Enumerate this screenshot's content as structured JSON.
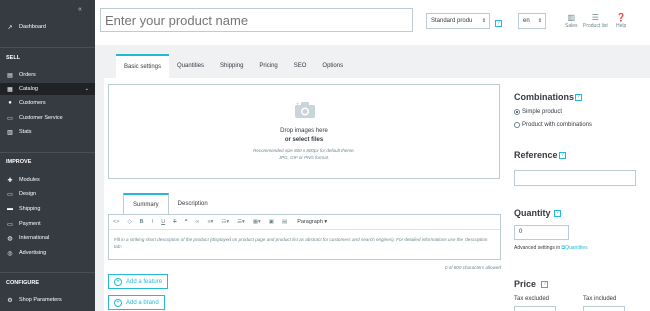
{
  "sidebar": {
    "collapse_glyph": "«",
    "dashboard": "Dashboard",
    "sections": {
      "sell": "SELL",
      "improve": "IMPROVE",
      "configure": "CONFIGURE"
    },
    "sell_items": [
      {
        "label": "Orders",
        "icon": "inbox-icon"
      },
      {
        "label": "Catalog",
        "icon": "store-icon",
        "active": true
      },
      {
        "label": "Customers",
        "icon": "user-icon"
      },
      {
        "label": "Customer Service",
        "icon": "chat-icon"
      },
      {
        "label": "Stats",
        "icon": "stats-icon"
      }
    ],
    "improve_items": [
      {
        "label": "Modules",
        "icon": "puzzle-icon"
      },
      {
        "label": "Design",
        "icon": "monitor-icon"
      },
      {
        "label": "Shipping",
        "icon": "truck-icon"
      },
      {
        "label": "Payment",
        "icon": "card-icon"
      },
      {
        "label": "International",
        "icon": "globe-icon"
      },
      {
        "label": "Advertising",
        "icon": "target-icon"
      }
    ],
    "configure_items": [
      {
        "label": "Shop Parameters",
        "icon": "gear-icon"
      }
    ]
  },
  "header": {
    "product_name_placeholder": "Enter your product name",
    "product_type": "Standard produ",
    "language": "en",
    "buttons": {
      "sales": "Sales",
      "product_list": "Product list",
      "help": "Help"
    }
  },
  "tabs": [
    "Basic settings",
    "Quantities",
    "Shipping",
    "Pricing",
    "SEO",
    "Options"
  ],
  "dropzone": {
    "title": "Drop images here",
    "subtitle": "or select files",
    "note1": "Recommended size 800 x 800px for default theme.",
    "note2": "JPG, GIF or PNG format."
  },
  "description": {
    "tabs": [
      "Summary",
      "Description"
    ],
    "paragraph_label": "Paragraph",
    "placeholder": "Fill in a striking short description of the product (displayed on product page and product list as abstract for customers and search engines). For detailed informations use the 'description tab'.",
    "counter": "0 of 800 characters allowed"
  },
  "buttons": {
    "add_feature": "Add a feature",
    "add_brand": "Add a brand"
  },
  "right": {
    "combinations_title": "Combinations",
    "simple_product": "Simple product",
    "with_combinations": "Product with combinations",
    "reference_title": "Reference",
    "quantity_title": "Quantity",
    "quantity_value": "0",
    "advanced_settings": "Advanced settings in",
    "quantities_link": "Quantities",
    "price_title": "Price",
    "tax_excluded": "Tax excluded",
    "tax_included": "Tax included"
  },
  "colors": {
    "accent": "#25b9d7",
    "sidebar": "#363a41",
    "active": "#202226"
  }
}
